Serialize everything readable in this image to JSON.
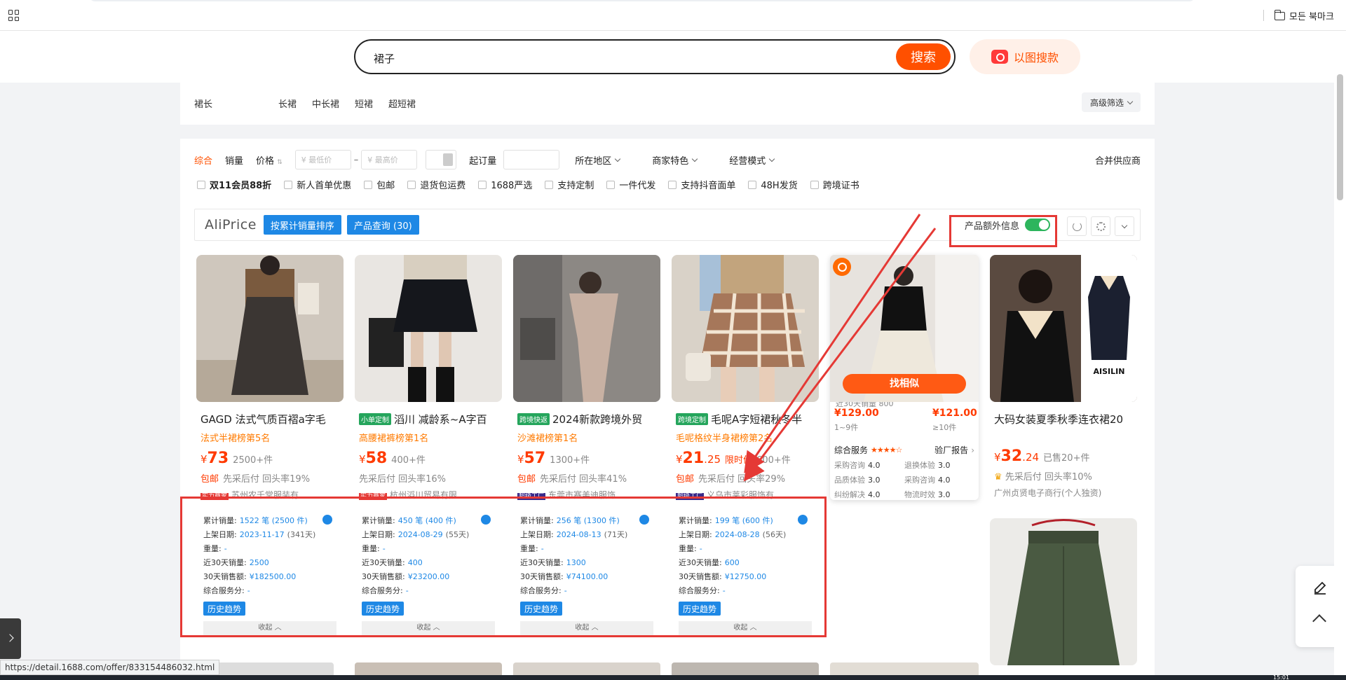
{
  "browser": {
    "bookmarks_label": "모든 북마크",
    "status_url": "https://detail.1688.com/offer/833154486032.html",
    "clock": "15:01"
  },
  "search": {
    "query": "裙子",
    "button": "搜索",
    "image_search": "以图搜款"
  },
  "length_filter": {
    "label": "裙长",
    "options": [
      "长裙",
      "中长裙",
      "短裙",
      "超短裙"
    ],
    "advanced": "高级筛选"
  },
  "sort": {
    "items": [
      "综合",
      "销量",
      "价格"
    ],
    "min_price_placeholder": "¥ 最低价",
    "max_price_placeholder": "¥ 最高价",
    "dash": "–",
    "moq_label": "起订量",
    "region": "所在地区",
    "features": "商家特色",
    "mode": "经营模式",
    "merge": "合并供应商"
  },
  "filters": [
    "双11会员88折",
    "新人首单优惠",
    "包邮",
    "退货包运费",
    "1688严选",
    "支持定制",
    "一件代发",
    "支持抖音面单",
    "48H发货",
    "跨境证书"
  ],
  "aliprice": {
    "logo": "AliPrice",
    "btn_sort": "按累计销量排序",
    "btn_query": "产品查询 (30)",
    "extra_info": "产品额外信息",
    "colors": {
      "accent": "#1e88e5",
      "switch_on": "#2db55d",
      "brand": "#ff5000"
    }
  },
  "labels": {
    "total_sales": "累计销量:",
    "list_date": "上架日期:",
    "weight": "重量:",
    "sales30": "近30天销量:",
    "revenue30": "30天销售额:",
    "service": "综合服务分:",
    "history": "历史趋势",
    "collapse": "收起 ︿",
    "post": "包邮"
  },
  "products": [
    {
      "title": "GAGD 法式气质百褶a字毛",
      "tag": "",
      "rank": "法式半裙榜第5名",
      "price_int": "73",
      "price_dec": "",
      "sold": "2500+件",
      "post": true,
      "meta": "先采后付  回头率19%",
      "badge": "实力商家",
      "shop": "苏州农千堂服装有",
      "total": "1522 笔 (2500 件)",
      "date": "2023-11-17",
      "days": "(341天)",
      "weight": "-",
      "s30": "2500",
      "rev30": "¥182500.00",
      "svc": "-"
    },
    {
      "title": "滔川 减龄系~A字百",
      "tag": "小单定制",
      "rank": "高腰裙裤榜第1名",
      "price_int": "58",
      "price_dec": "",
      "sold": "400+件",
      "post": false,
      "meta": "先采后付  回头率16%",
      "badge": "实力商家",
      "shop": "杭州滔川贸易有限",
      "total": "450 笔 (400 件)",
      "date": "2024-08-29",
      "days": "(55天)",
      "weight": "-",
      "s30": "400",
      "rev30": "¥23200.00",
      "svc": "-"
    },
    {
      "title": "2024新款跨境外贸",
      "tag": "跨境快返",
      "rank": "沙滩裙榜第1名",
      "price_int": "57",
      "price_dec": "",
      "sold": "1300+件",
      "post": true,
      "meta": "先采后付  回头率41%",
      "badge": "超级工厂",
      "shop": "东莞市赛美迪服饰",
      "total": "256 笔 (1300 件)",
      "date": "2024-08-13",
      "days": "(71天)",
      "weight": "-",
      "s30": "1300",
      "rev30": "¥74100.00",
      "svc": "-"
    },
    {
      "title": "毛呢A字短裙秋冬半",
      "tag": "跨境定制",
      "rank": "毛呢格纹半身裙榜第2名",
      "price_int": "21",
      "price_dec": ".25",
      "promo": "限时价",
      "sold": "600+件",
      "post": true,
      "meta": "先采后付  回头率29%",
      "badge": "超级工厂",
      "shop": "义乌市莱彩服饰有",
      "total": "199 笔 (600 件)",
      "date": "2024-08-28",
      "days": "(56天)",
      "weight": "-",
      "s30": "600",
      "rev30": "¥12750.00",
      "svc": "-"
    }
  ],
  "hover_card": {
    "find_similar": "找相似",
    "peek": "近30天销量 800",
    "p1": "¥129.00",
    "q1": "1~9件",
    "p2": "¥121.00",
    "q2": "≥10件",
    "service": "综合服务",
    "stars": "★★★★☆",
    "report": "验厂报告",
    "scores": [
      [
        "采购咨询",
        "4.0"
      ],
      [
        "退换体验",
        "3.0"
      ],
      [
        "品质体验",
        "3.0"
      ],
      [
        "采购咨询",
        "4.0"
      ],
      [
        "纠纷解决",
        "4.0"
      ],
      [
        "物流时效",
        "3.0"
      ]
    ]
  },
  "card6": {
    "title": "大码女装夏季秋季连衣裙20",
    "price_int": "32",
    "price_dec": ".24",
    "sold": "已售20+件",
    "meta": "先采后付  回头率10%",
    "shop": "广州贞贤电子商行(个人独资)",
    "img_brand": "AISILIN"
  }
}
